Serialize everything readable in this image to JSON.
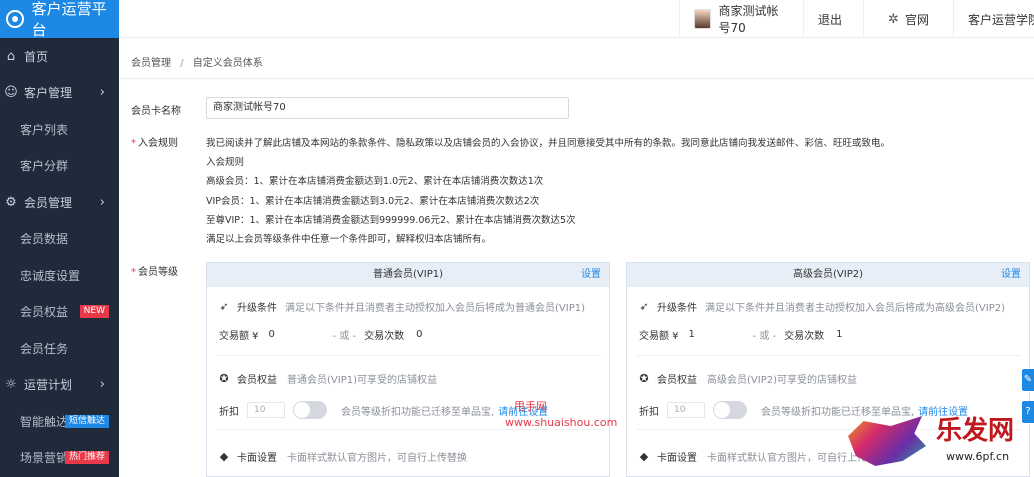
{
  "app": {
    "title": "客户运营平台"
  },
  "sidebar": {
    "items": [
      {
        "label": "首页",
        "icon": "home-icon"
      },
      {
        "label": "客户管理",
        "icon": "users-icon",
        "arrow": "›"
      },
      {
        "label": "客户列表"
      },
      {
        "label": "客户分群"
      },
      {
        "label": "会员管理",
        "icon": "gear-icon",
        "arrow": "›"
      },
      {
        "label": "会员数据"
      },
      {
        "label": "忠诚度设置"
      },
      {
        "label": "会员权益",
        "tag": "NEW"
      },
      {
        "label": "会员任务"
      },
      {
        "label": "运营计划",
        "icon": "bulb-icon",
        "arrow": "›"
      },
      {
        "label": "智能触达",
        "tag": "短信触达"
      },
      {
        "label": "场景营销",
        "tag": "热门推荐"
      }
    ]
  },
  "topbar": {
    "account": "商家测试帐号70",
    "logout": "退出",
    "site": "官网",
    "college": "客户运营学院"
  },
  "breadcrumb": {
    "parent": "会员管理",
    "sep": "/",
    "current": "自定义会员体系"
  },
  "form": {
    "card_name_label": "会员卡名称",
    "card_name_value": "商家测试帐号70",
    "join_rules_label": "入会规则",
    "join_rules_lines": [
      "我已阅读并了解此店铺及本网站的条款条件、隐私政策以及店铺会员的入会协议，并且同意接受其中所有的条款。我同意此店铺向我发送邮件、彩信、旺旺或致电。",
      "入会规则",
      "高级会员：1、累计在本店铺消费金额达到1.0元2、累计在本店铺消费次数达1次",
      "VIP会员：1、累计在本店铺消费金额达到3.0元2、累计在本店铺消费次数达2次",
      "至尊VIP：1、累计在本店铺消费金额达到999999.06元2、累计在本店铺消费次数达5次",
      "满足以上会员等级条件中任意一个条件即可，解释权归本店铺所有。"
    ],
    "level_label": "会员等级"
  },
  "levels": [
    {
      "title": "普通会员(VIP1)",
      "settings": "设置",
      "upgrade_label": "升级条件",
      "upgrade_desc": "满足以下条件并且消费者主动授权加入会员后将成为普通会员(VIP1)",
      "amount_label": "交易额 ¥",
      "amount_value": "0",
      "or": "- 或 -",
      "count_label": "交易次数",
      "count_value": "0",
      "rights_label": "会员权益",
      "rights_desc": "普通会员(VIP1)可享受的店铺权益",
      "discount_label": "折扣",
      "discount_placeholder": "10",
      "discount_note": "会员等级折扣功能已迁移至单品宝,",
      "discount_link": "请前往设置",
      "card_label": "卡面设置",
      "card_desc": "卡面样式默认官方图片，可自行上传替换"
    },
    {
      "title": "高级会员(VIP2)",
      "settings": "设置",
      "upgrade_label": "升级条件",
      "upgrade_desc": "满足以下条件并且消费者主动授权加入会员后将成为高级会员(VIP2)",
      "amount_label": "交易额 ¥",
      "amount_value": "1",
      "or": "- 或 -",
      "count_label": "交易次数",
      "count_value": "1",
      "rights_label": "会员权益",
      "rights_desc": "高级会员(VIP2)可享受的店铺权益",
      "discount_label": "折扣",
      "discount_placeholder": "10",
      "discount_note": "会员等级折扣功能已迁移至单品宝,",
      "discount_link": "请前往设置",
      "card_label": "卡面设置",
      "card_desc": "卡面样式默认官方图片，可自行上传替换"
    }
  ],
  "watermarks": {
    "text1": "甩手网",
    "text2": "www.shuaishou.com",
    "logo_text": "乐发网",
    "logo_url": "www.6pf.cn"
  },
  "colors": {
    "sidebar_bg": "#1f2a3a",
    "brand_blue": "#1e88e5",
    "tag_red": "#e8394a"
  }
}
